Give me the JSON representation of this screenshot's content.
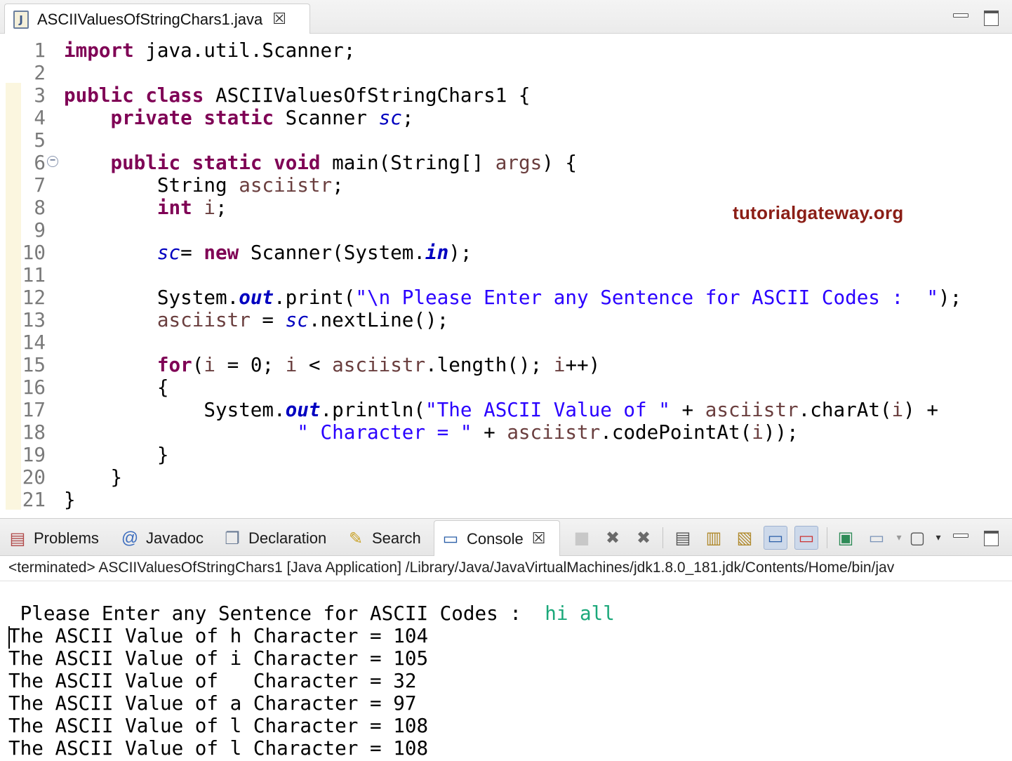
{
  "editor": {
    "tab_label": "ASCIIValuesOfStringChars1.java",
    "tab_close": "☒",
    "file_icon_letter": "J",
    "watermark": "tutorialgateway.org",
    "folding_marker": "−",
    "lines": [
      {
        "n": "1",
        "tokens": [
          [
            "kw",
            "import"
          ],
          [
            "p",
            " java.util.Scanner;"
          ]
        ]
      },
      {
        "n": "2",
        "tokens": []
      },
      {
        "n": "3",
        "tokens": [
          [
            "kw",
            "public"
          ],
          [
            "p",
            " "
          ],
          [
            "kw",
            "class"
          ],
          [
            "p",
            " ASCIIValuesOfStringChars1 {"
          ]
        ]
      },
      {
        "n": "4",
        "tokens": [
          [
            "p",
            "    "
          ],
          [
            "kw",
            "private"
          ],
          [
            "p",
            " "
          ],
          [
            "kw",
            "static"
          ],
          [
            "p",
            " Scanner "
          ],
          [
            "fld",
            "sc"
          ],
          [
            "p",
            ";"
          ]
        ]
      },
      {
        "n": "5",
        "tokens": []
      },
      {
        "n": "6",
        "tokens": [
          [
            "p",
            "    "
          ],
          [
            "kw",
            "public"
          ],
          [
            "p",
            " "
          ],
          [
            "kw",
            "static"
          ],
          [
            "p",
            " "
          ],
          [
            "kw",
            "void"
          ],
          [
            "p",
            " main(String[] "
          ],
          [
            "var",
            "args"
          ],
          [
            "p",
            ") {"
          ]
        ]
      },
      {
        "n": "7",
        "tokens": [
          [
            "p",
            "        String "
          ],
          [
            "var",
            "asciistr"
          ],
          [
            "p",
            ";"
          ]
        ]
      },
      {
        "n": "8",
        "tokens": [
          [
            "p",
            "        "
          ],
          [
            "kw",
            "int"
          ],
          [
            "p",
            " "
          ],
          [
            "var",
            "i"
          ],
          [
            "p",
            ";"
          ]
        ]
      },
      {
        "n": "9",
        "tokens": []
      },
      {
        "n": "10",
        "tokens": [
          [
            "p",
            "        "
          ],
          [
            "fld",
            "sc"
          ],
          [
            "p",
            "= "
          ],
          [
            "kw",
            "new"
          ],
          [
            "p",
            " Scanner(System."
          ],
          [
            "sfld",
            "in"
          ],
          [
            "p",
            ");"
          ]
        ]
      },
      {
        "n": "11",
        "tokens": []
      },
      {
        "n": "12",
        "tokens": [
          [
            "p",
            "        System."
          ],
          [
            "sfld",
            "out"
          ],
          [
            "p",
            ".print("
          ],
          [
            "str",
            "\"\\n Please Enter any Sentence for ASCII Codes :  \""
          ],
          [
            "p",
            ");"
          ]
        ]
      },
      {
        "n": "13",
        "tokens": [
          [
            "p",
            "        "
          ],
          [
            "var",
            "asciistr"
          ],
          [
            "p",
            " = "
          ],
          [
            "fld",
            "sc"
          ],
          [
            "p",
            ".nextLine();"
          ]
        ]
      },
      {
        "n": "14",
        "tokens": []
      },
      {
        "n": "15",
        "tokens": [
          [
            "p",
            "        "
          ],
          [
            "kw",
            "for"
          ],
          [
            "p",
            "("
          ],
          [
            "var",
            "i"
          ],
          [
            "p",
            " = 0; "
          ],
          [
            "var",
            "i"
          ],
          [
            "p",
            " < "
          ],
          [
            "var",
            "asciistr"
          ],
          [
            "p",
            ".length(); "
          ],
          [
            "var",
            "i"
          ],
          [
            "p",
            "++)"
          ]
        ]
      },
      {
        "n": "16",
        "tokens": [
          [
            "p",
            "        {"
          ]
        ]
      },
      {
        "n": "17",
        "tokens": [
          [
            "p",
            "            System."
          ],
          [
            "sfld",
            "out"
          ],
          [
            "p",
            ".println("
          ],
          [
            "str",
            "\"The ASCII Value of \""
          ],
          [
            "p",
            " + "
          ],
          [
            "var",
            "asciistr"
          ],
          [
            "p",
            ".charAt("
          ],
          [
            "var",
            "i"
          ],
          [
            "p",
            ") +"
          ]
        ]
      },
      {
        "n": "18",
        "tokens": [
          [
            "p",
            "                    "
          ],
          [
            "str",
            "\" Character = \""
          ],
          [
            "p",
            " + "
          ],
          [
            "var",
            "asciistr"
          ],
          [
            "p",
            ".codePointAt("
          ],
          [
            "var",
            "i"
          ],
          [
            "p",
            "));"
          ]
        ]
      },
      {
        "n": "19",
        "tokens": [
          [
            "p",
            "        }"
          ]
        ]
      },
      {
        "n": "20",
        "tokens": [
          [
            "p",
            "    }"
          ]
        ]
      },
      {
        "n": "21",
        "tokens": [
          [
            "p",
            "}"
          ]
        ]
      }
    ]
  },
  "views": {
    "tabs": [
      {
        "key": "problems",
        "label": "Problems",
        "icon": "problems-icon",
        "glyph": "▤"
      },
      {
        "key": "javadoc",
        "label": "Javadoc",
        "icon": "at-icon",
        "glyph": "@"
      },
      {
        "key": "declaration",
        "label": "Declaration",
        "icon": "declaration-icon",
        "glyph": "❐"
      },
      {
        "key": "search",
        "label": "Search",
        "icon": "flashlight-icon",
        "glyph": "✎"
      },
      {
        "key": "console",
        "label": "Console",
        "icon": "console-icon",
        "glyph": "▭"
      }
    ],
    "console_close": "☒"
  },
  "console": {
    "header": "<terminated> ASCIIValuesOfStringChars1 [Java Application] /Library/Java/JavaVirtualMachines/jdk1.8.0_181.jdk/Contents/Home/bin/jav",
    "prompt": " Please Enter any Sentence for ASCII Codes :  ",
    "user_input": "hi all",
    "output_lines": [
      "The ASCII Value of h Character = 104",
      "The ASCII Value of i Character = 105",
      "The ASCII Value of   Character = 32",
      "The ASCII Value of a Character = 97",
      "The ASCII Value of l Character = 108",
      "The ASCII Value of l Character = 108"
    ]
  },
  "colors": {
    "keyword": "#7f0055",
    "string": "#2a00ff",
    "field": "#0000c0",
    "local_var": "#6a3e3e",
    "console_input": "#1ba87a",
    "watermark": "#8b1e16"
  }
}
